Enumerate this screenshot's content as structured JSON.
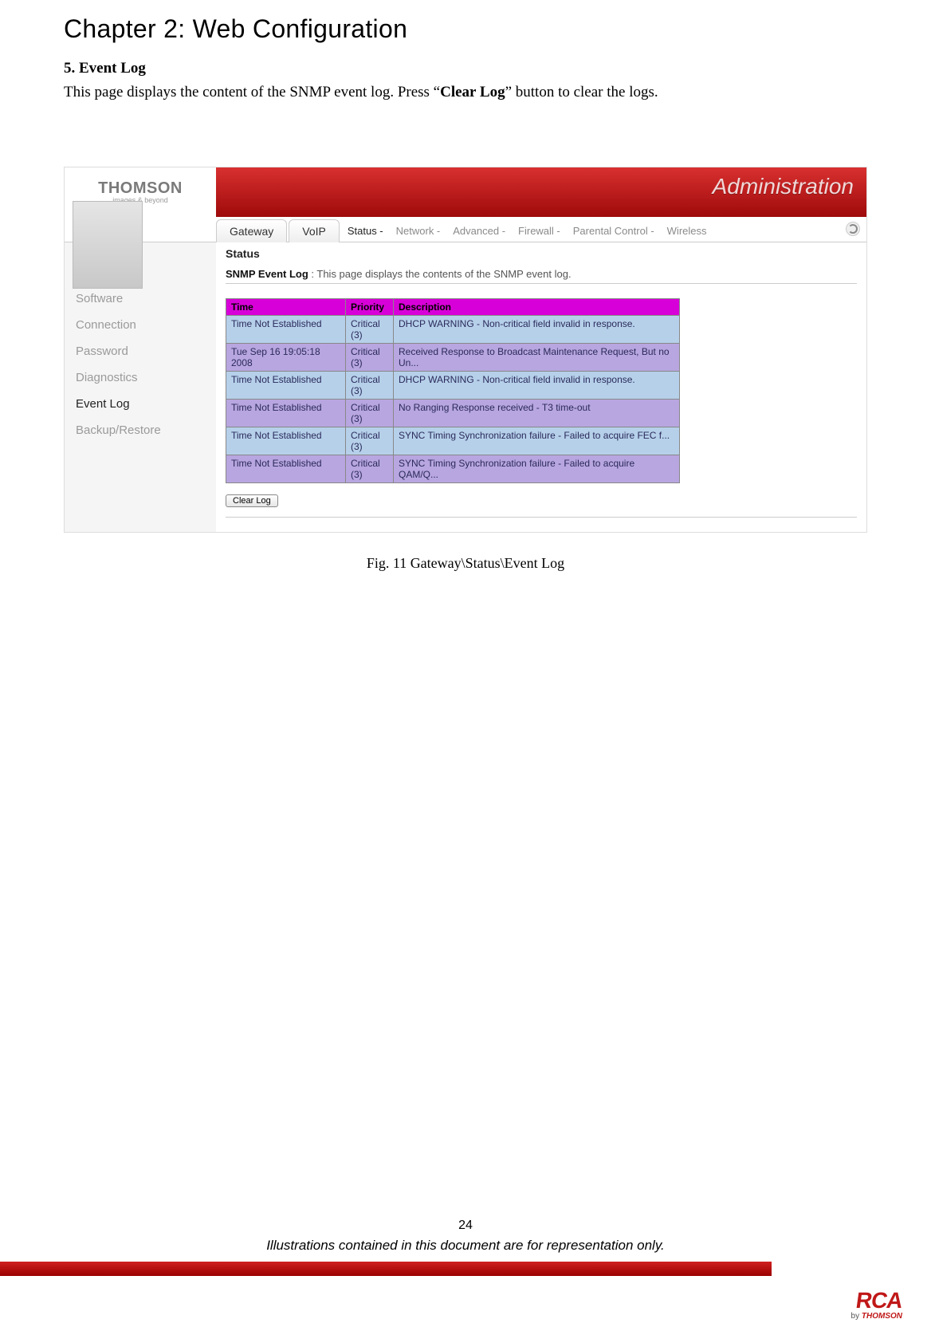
{
  "chapter_title": "Chapter 2: Web Configuration",
  "section_title": "5. Event Log",
  "section_body_pre": "This page displays the content of the SNMP event log. Press “",
  "section_body_bold": "Clear Log",
  "section_body_post": "” button to clear the logs.",
  "caption": "Fig. 11 Gateway\\Status\\Event Log",
  "page_number": "24",
  "disclaimer": "Illustrations contained in this document are for representation only.",
  "shot": {
    "logo_title": "THOMSON",
    "logo_sub": "images & beyond",
    "banner_title": "Administration",
    "tabs": {
      "gateway": "Gateway",
      "voip": "VoIP"
    },
    "subnav": {
      "status": "Status -",
      "network": "Network -",
      "advanced": "Advanced -",
      "firewall": "Firewall -",
      "parental": "Parental Control -",
      "wireless": "Wireless"
    },
    "side_items": {
      "software": "Software",
      "connection": "Connection",
      "password": "Password",
      "diagnostics": "Diagnostics",
      "eventlog": "Event Log",
      "backup": "Backup/Restore"
    },
    "status_label": "Status",
    "snmp_label": "SNMP Event Log",
    "snmp_colon": " : ",
    "snmp_desc": "This page displays the contents of the SNMP event log.",
    "table": {
      "headers": {
        "time": "Time",
        "priority": "Priority",
        "description": "Description"
      },
      "rows": [
        {
          "cls": "blue",
          "time": "Time Not Established",
          "priority": "Critical (3)",
          "desc": " DHCP WARNING - Non-critical field invalid in response."
        },
        {
          "cls": "purple",
          "time": " Tue Sep 16 19:05:18 2008",
          "priority": "Critical (3)",
          "desc": " Received Response to Broadcast Maintenance Request, But no Un..."
        },
        {
          "cls": "blue",
          "time": "Time Not Established",
          "priority": "Critical (3)",
          "desc": " DHCP WARNING - Non-critical field invalid in response."
        },
        {
          "cls": "purple",
          "time": "Time Not Established",
          "priority": "Critical (3)",
          "desc": " No Ranging Response received - T3 time-out"
        },
        {
          "cls": "blue",
          "time": "Time Not Established",
          "priority": "Critical (3)",
          "desc": " SYNC Timing Synchronization failure - Failed to acquire FEC f..."
        },
        {
          "cls": "purple",
          "time": "Time Not Established",
          "priority": "Critical (3)",
          "desc": " SYNC Timing Synchronization failure - Failed to acquire QAM/Q..."
        }
      ]
    },
    "clear_button": "Clear Log"
  },
  "footer_logo": {
    "rca": "RCA",
    "by_pre": "by ",
    "by_brand": "THOMSON"
  }
}
